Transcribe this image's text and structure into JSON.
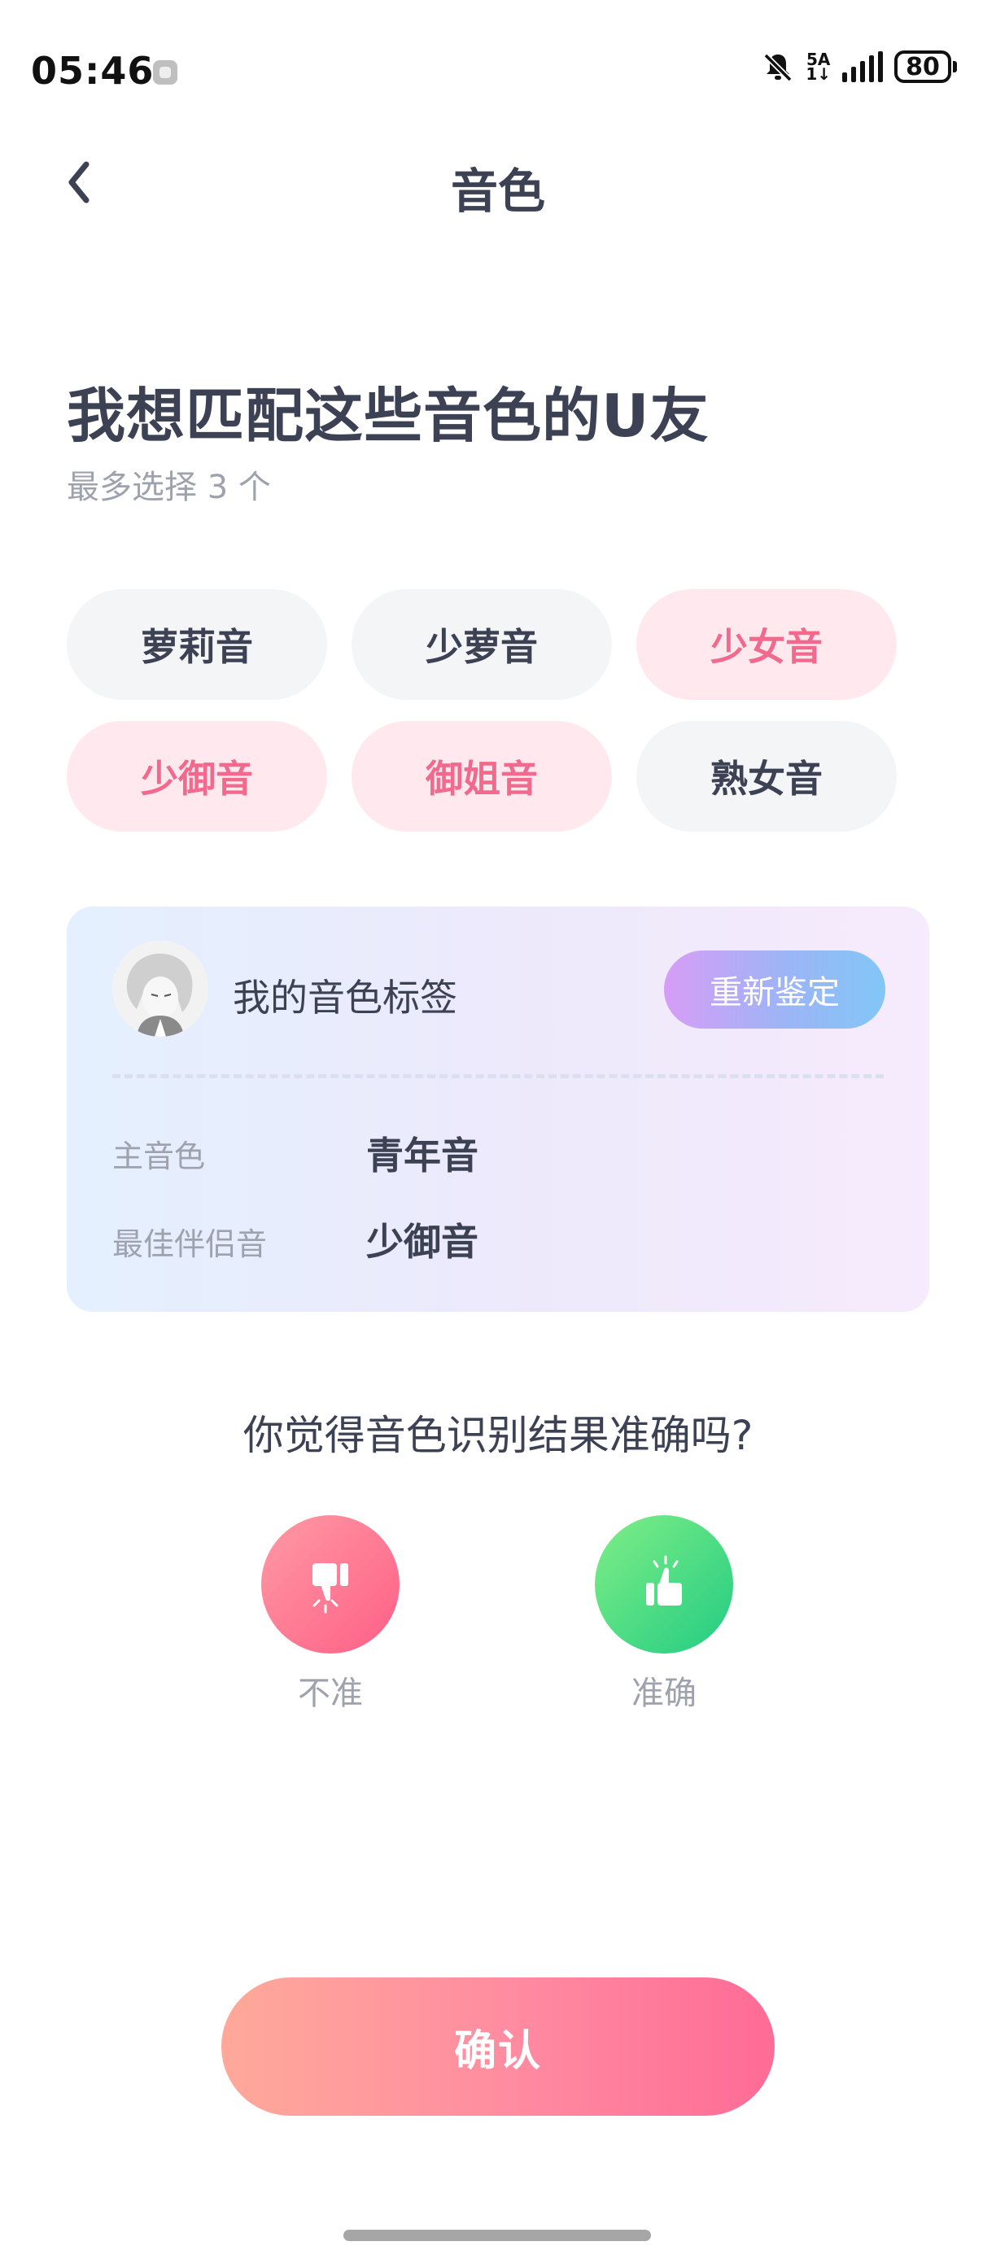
{
  "status_bar": {
    "time": "05:46",
    "network_top": "5A",
    "network_bottom": "1↓",
    "battery": "80"
  },
  "header": {
    "title": "音色"
  },
  "intro": {
    "heading": "我想匹配这些音色的U友",
    "subheading": "最多选择 3 个"
  },
  "voice_tags": [
    {
      "label": "萝莉音",
      "selected": false
    },
    {
      "label": "少萝音",
      "selected": false
    },
    {
      "label": "少女音",
      "selected": true
    },
    {
      "label": "少御音",
      "selected": true
    },
    {
      "label": "御姐音",
      "selected": true
    },
    {
      "label": "熟女音",
      "selected": false
    }
  ],
  "my_voice": {
    "title": "我的音色标签",
    "reassess_label": "重新鉴定",
    "main_voice_label": "主音色",
    "main_voice_value": "青年音",
    "best_partner_label": "最佳伴侣音",
    "best_partner_value": "少御音"
  },
  "feedback": {
    "question": "你觉得音色识别结果准确吗?",
    "inaccurate_label": "不准",
    "accurate_label": "准确"
  },
  "confirm_label": "确认",
  "colors": {
    "accent_pink": "#f2698e",
    "selected_bg": "#ffe9ef",
    "unselected_bg": "#f4f5f7",
    "text_dark": "#3c4154",
    "text_gray": "#9ea2ad"
  }
}
